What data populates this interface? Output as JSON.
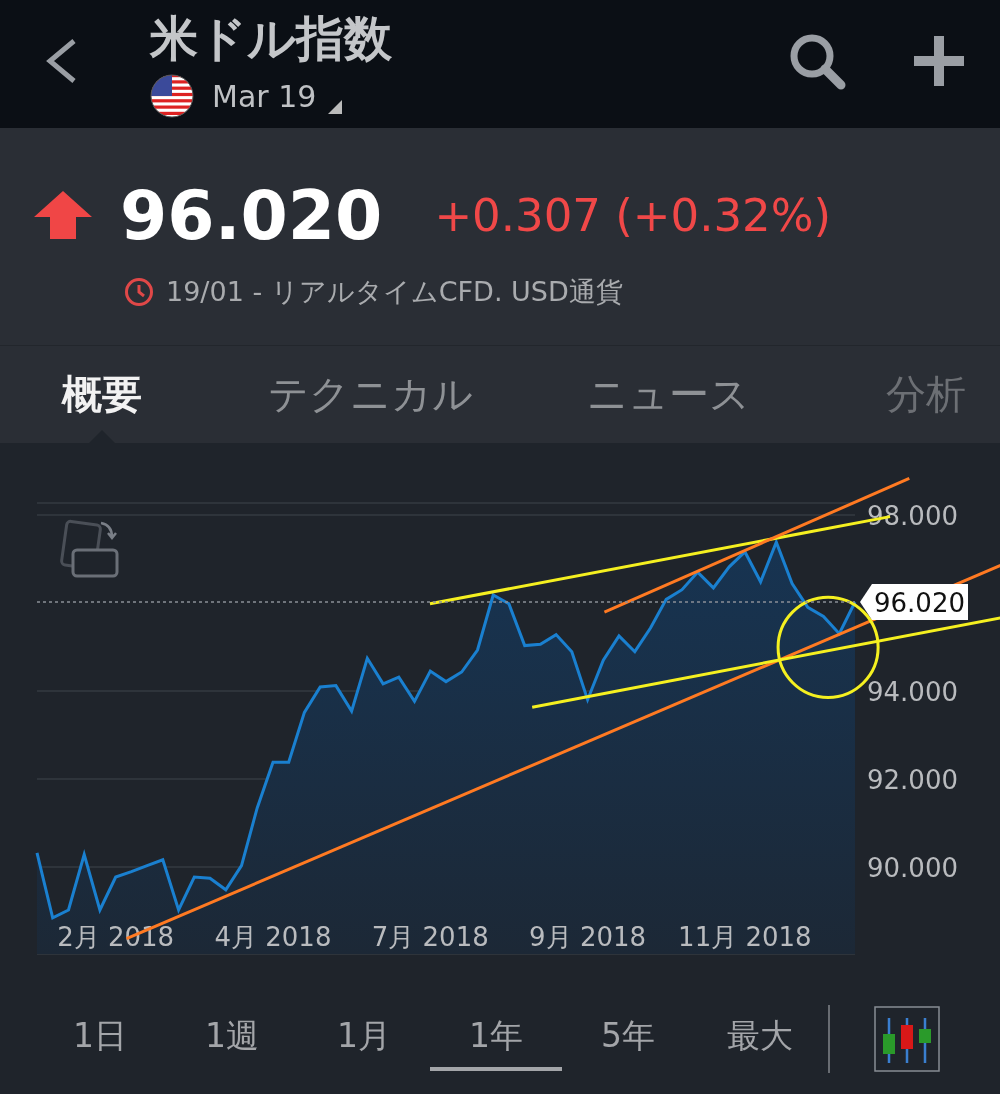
{
  "header": {
    "title": "米ドル指数",
    "contract": "Mar 19"
  },
  "quote": {
    "price": "96.020",
    "rising": true,
    "change": "+0.307 (+0.32%)",
    "status": "19/01 - リアルタイムCFD. USD通貨"
  },
  "tabs": [
    {
      "label": "概要",
      "selected": true
    },
    {
      "label": "テクニカル",
      "selected": false
    },
    {
      "label": "ニュース",
      "selected": false
    },
    {
      "label": "分析",
      "selected": false
    }
  ],
  "chart": {
    "chart_data": {
      "type": "area",
      "categories": [
        null,
        null,
        null,
        null,
        null,
        "2月 2018",
        null,
        null,
        null,
        null,
        null,
        null,
        null,
        null,
        null,
        "4月 2018",
        null,
        null,
        null,
        null,
        null,
        null,
        null,
        null,
        null,
        "7月 2018",
        null,
        null,
        null,
        null,
        null,
        null,
        null,
        null,
        null,
        "9月 2018",
        null,
        null,
        null,
        null,
        null,
        null,
        null,
        null,
        null,
        "11月 2018",
        null,
        null,
        null,
        null,
        null,
        null,
        null
      ],
      "series": [
        {
          "color": "#1a80d0",
          "values": [
            90.32,
            88.84,
            89.02,
            90.28,
            89.02,
            89.77,
            89.89,
            90.03,
            90.16,
            89.02,
            89.77,
            89.74,
            89.48,
            90.03,
            91.34,
            92.38,
            92.38,
            93.51,
            94.09,
            94.12,
            93.54,
            94.74,
            94.16,
            94.31,
            93.76,
            94.45,
            94.21,
            94.43,
            94.93,
            96.18,
            95.98,
            95.03,
            95.06,
            95.28,
            94.89,
            93.8,
            94.7,
            95.25,
            94.89,
            95.43,
            96.08,
            96.3,
            96.7,
            96.34,
            96.82,
            97.16,
            96.48,
            97.38,
            96.44,
            95.9,
            95.69,
            95.3,
            96.02
          ]
        }
      ],
      "ylim": [
        88.02,
        98.27
      ],
      "yticks": [
        {
          "value": 90,
          "label": "90.000"
        },
        {
          "value": 92,
          "label": "92.000"
        },
        {
          "value": 94,
          "label": "94.000"
        },
        {
          "value": 98,
          "label": "98.000"
        }
      ],
      "grid": true
    },
    "current_price_tag": "96.020"
  },
  "ranges": [
    {
      "label": "1日",
      "selected": false
    },
    {
      "label": "1週",
      "selected": false
    },
    {
      "label": "1月",
      "selected": false
    },
    {
      "label": "1年",
      "selected": true
    },
    {
      "label": "5年",
      "selected": false
    },
    {
      "label": "最大",
      "selected": false
    }
  ]
}
